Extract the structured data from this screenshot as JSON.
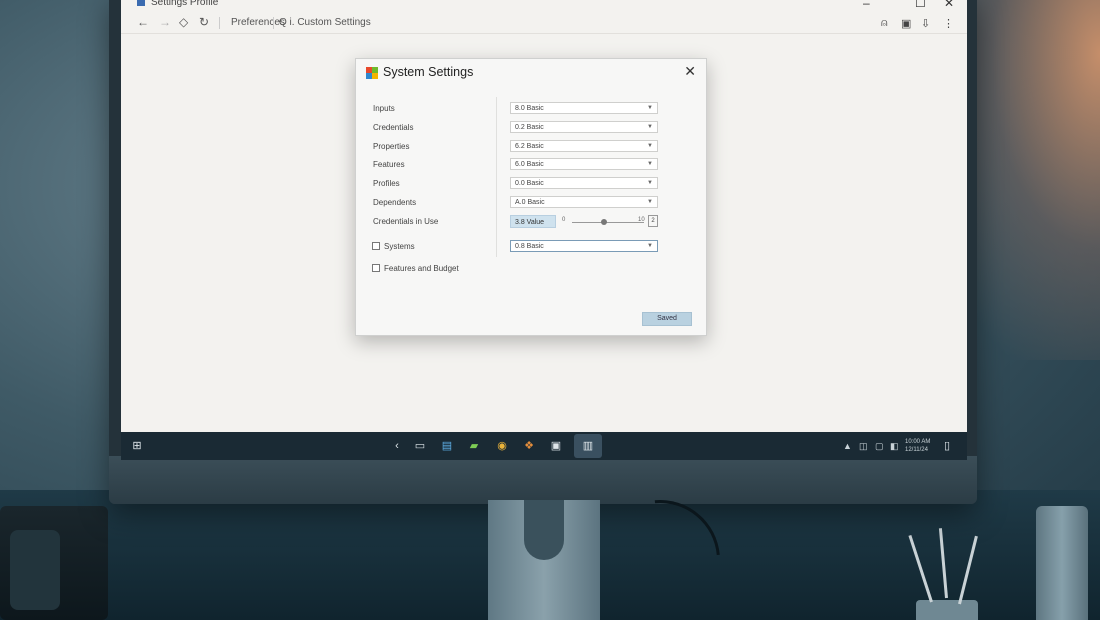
{
  "browser": {
    "window_title": "Settings Profile",
    "nav": {
      "back_icon": "back-arrow-icon",
      "forward_icon": "forward-arrow-icon",
      "breadcrumb": "Preferences",
      "address": "Q  i. Custom Settings"
    },
    "window_controls": {
      "minimize": "–",
      "maximize": "☐",
      "close": "✕"
    }
  },
  "dialog": {
    "title": "System Settings",
    "close_label": "✕",
    "logo_colors": [
      "#e8492c",
      "#6fba2c",
      "#2f88d0",
      "#f4b400"
    ],
    "rows": [
      {
        "label": "Inputs",
        "value": "8.0 Basic"
      },
      {
        "label": "Credentials",
        "value": "0.2 Basic"
      },
      {
        "label": "Properties",
        "value": "6.2 Basic"
      },
      {
        "label": "Features",
        "value": "6.0 Basic"
      },
      {
        "label": "Profiles",
        "value": "0.0 Basic"
      },
      {
        "label": "Dependents",
        "value": "A.0 Basic"
      }
    ],
    "slider_row": {
      "label": "Credentials in Use",
      "value": "3.8 Value",
      "min_label": "0",
      "max_label": "10",
      "level": 0.45,
      "stepper_label": "2"
    },
    "check_rows": [
      {
        "label": "Systems",
        "checked": false,
        "value": "0.8 Basic"
      },
      {
        "label": "Features and Budget",
        "checked": false
      }
    ],
    "save_label": "Saved"
  },
  "taskbar": {
    "start_icon": "windows-start-icon",
    "tray_time": "10:00 AM",
    "tray_date": "12/11/24"
  }
}
